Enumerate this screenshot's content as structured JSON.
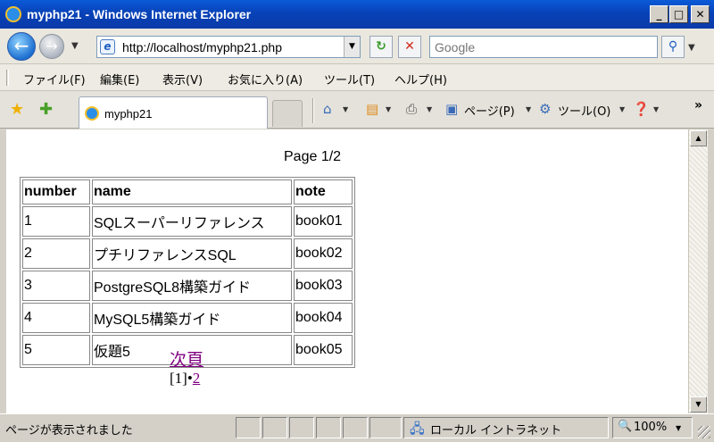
{
  "window": {
    "title": "myphp21 - Windows Internet Explorer"
  },
  "address": {
    "url": "http://localhost/myphp21.php"
  },
  "search": {
    "placeholder": "Google"
  },
  "menu": {
    "items": [
      "ファイル(F)",
      "編集(E)",
      "表示(V)",
      "お気に入り(A)",
      "ツール(T)",
      "ヘルプ(H)"
    ]
  },
  "tab": {
    "label": "myphp21"
  },
  "commands": {
    "page": "ページ(P)",
    "tools": "ツール(O)"
  },
  "content": {
    "page_indicator": "Page 1/2",
    "table": {
      "headers": [
        "number",
        "name",
        "note"
      ],
      "rows": [
        [
          "1",
          "SQLスーパーリファレンス",
          "book01"
        ],
        [
          "2",
          "プチリファレンスSQL",
          "book02"
        ],
        [
          "3",
          "PostgreSQL8構築ガイド",
          "book03"
        ],
        [
          "4",
          "MySQL5構築ガイド",
          "book04"
        ],
        [
          "5",
          "仮題5",
          "book05"
        ]
      ]
    },
    "next_link": "次頁",
    "pager": {
      "current": "[1]",
      "separator": "•",
      "next_page": "2"
    }
  },
  "status": {
    "text": "ページが表示されました",
    "zone": "ローカル イントラネット",
    "zoom": "100%"
  },
  "colors": {
    "titlebar": "#0842b8",
    "visited_link": "#800080"
  }
}
